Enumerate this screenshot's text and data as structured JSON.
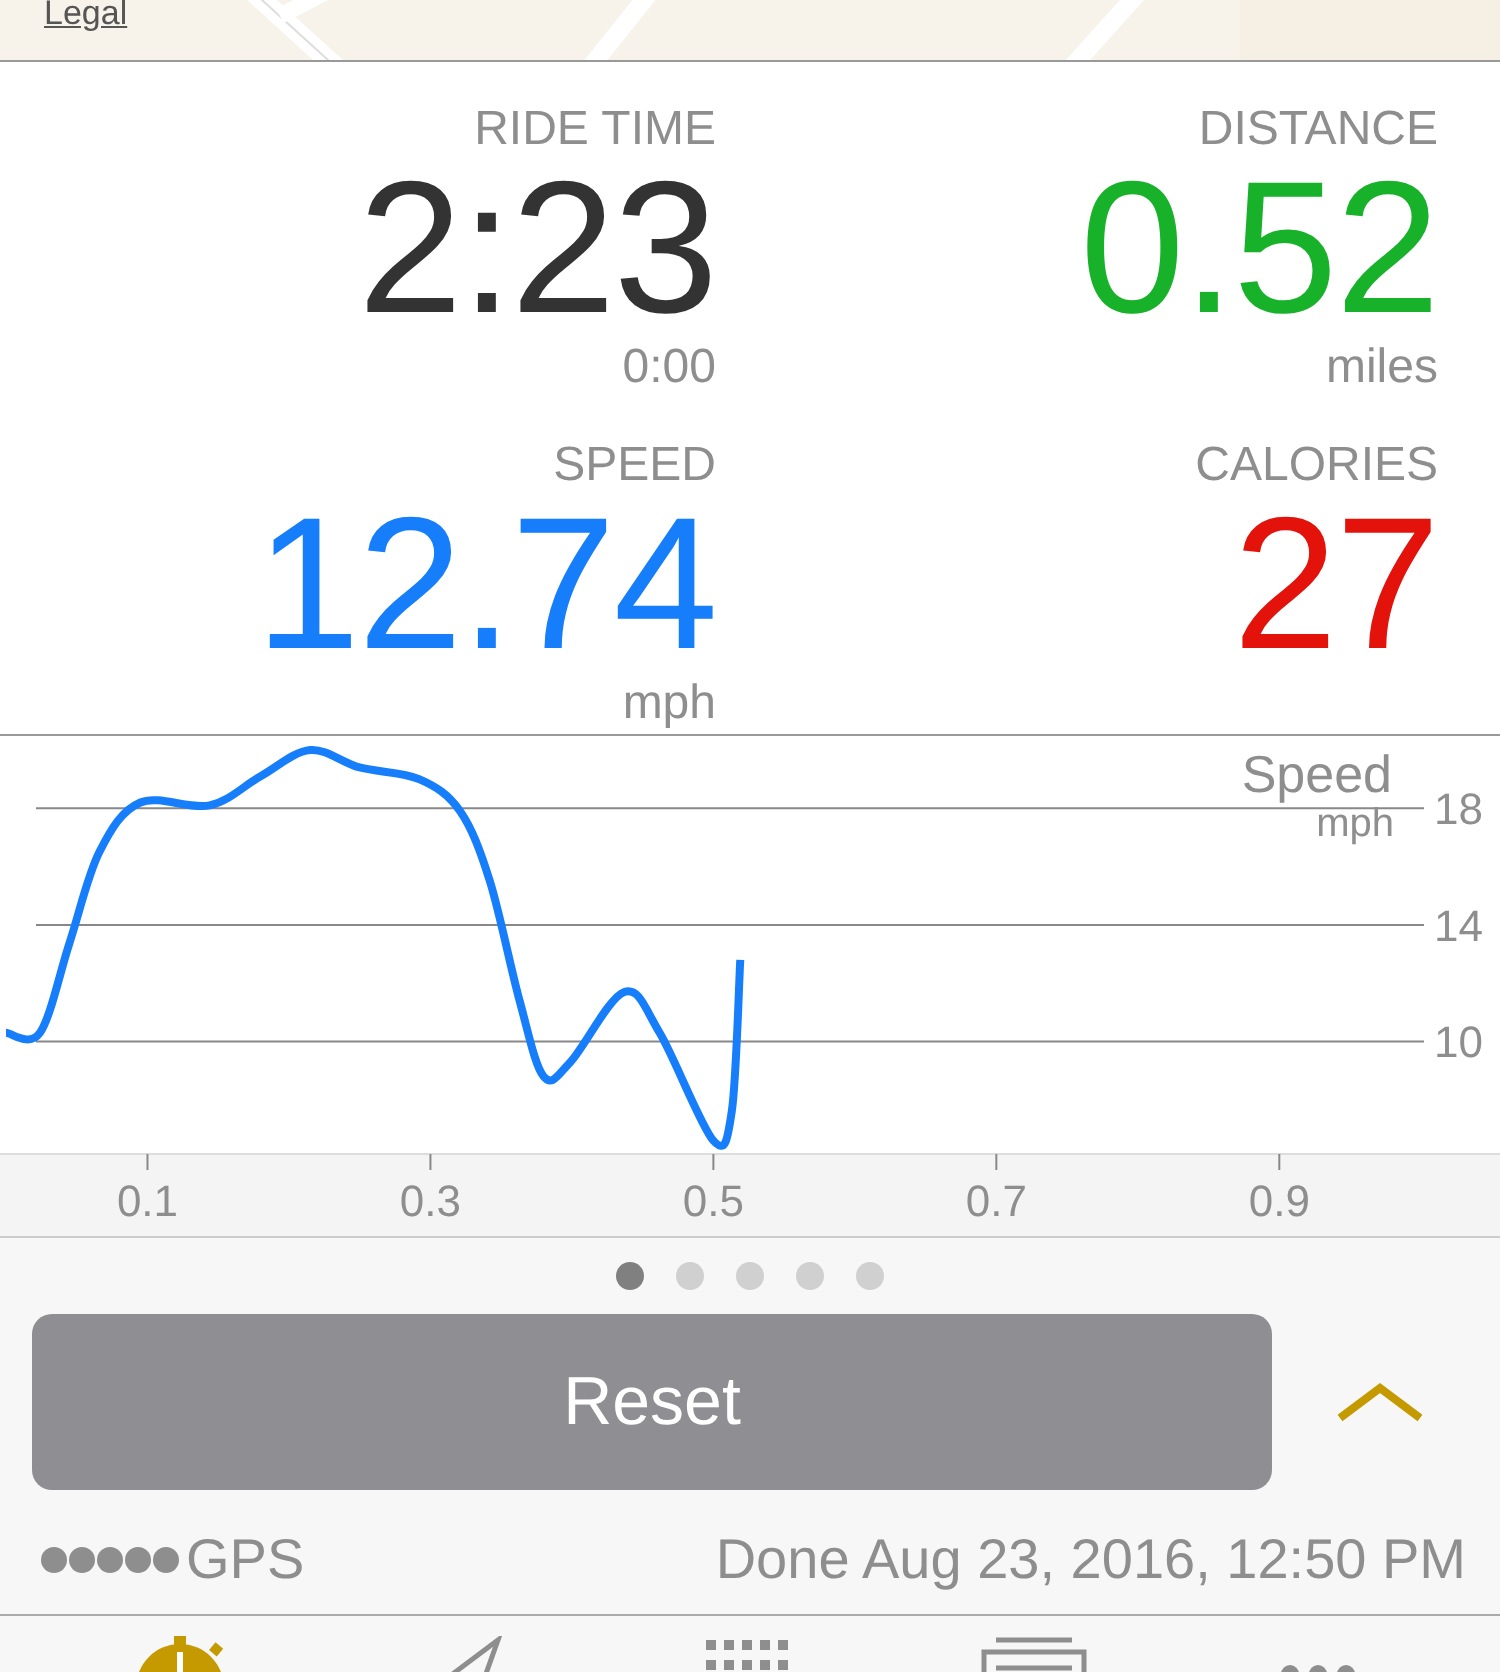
{
  "map": {
    "kind": "picture",
    "legal_link": "Legal"
  },
  "stats": [
    {
      "label": "RIDE TIME",
      "value": "2:23",
      "unit": "0:00",
      "color": "#333333"
    },
    {
      "label": "DISTANCE",
      "value": "0.52",
      "unit": "miles",
      "color": "#18b22a"
    },
    {
      "label": "SPEED",
      "value": "12.74",
      "unit": "mph",
      "color": "#167efb"
    },
    {
      "label": "CALORIES",
      "value": "27",
      "color": "#e3120b"
    }
  ],
  "chart": {
    "chart_data": {
      "type": "line",
      "title": "Speed",
      "ylabel": "mph",
      "x": [
        0,
        0.024,
        0.045,
        0.066,
        0.095,
        0.144,
        0.18,
        0.215,
        0.25,
        0.292,
        0.321,
        0.342,
        0.363,
        0.38,
        0.399,
        0.437,
        0.462,
        0.5,
        0.513,
        0.519
      ],
      "series": [
        {
          "color": "#167efb",
          "values": [
            10.3,
            10.3,
            13.4,
            16.5,
            18.2,
            18.1,
            19.1,
            20.0,
            19.4,
            19.0,
            17.9,
            15.5,
            11.4,
            8.8,
            9.3,
            11.7,
            10.3,
            6.6,
            7.6,
            12.8
          ]
        }
      ],
      "xlim": [
        0,
        1.056
      ],
      "ylim": [
        6.14,
        20.48
      ],
      "xticks": [
        0.1,
        0.3,
        0.5,
        0.7,
        0.9
      ],
      "yticks": [
        10,
        14,
        18
      ],
      "grid": true
    }
  },
  "pages": [
    {
      "selected": true
    },
    {
      "selected": false
    },
    {
      "selected": false
    },
    {
      "selected": false
    },
    {
      "selected": false
    }
  ],
  "reset_button": "Reset",
  "status": {
    "gps_label": "GPS",
    "done_text": "Done Aug 23, 2016, 12:50 PM"
  },
  "tabs": [
    {
      "kind": "stopwatch",
      "selected": true
    },
    {
      "kind": "plane",
      "selected": false
    },
    {
      "kind": "grid",
      "selected": false
    },
    {
      "kind": "list",
      "selected": false
    },
    {
      "kind": "more",
      "selected": false
    }
  ]
}
